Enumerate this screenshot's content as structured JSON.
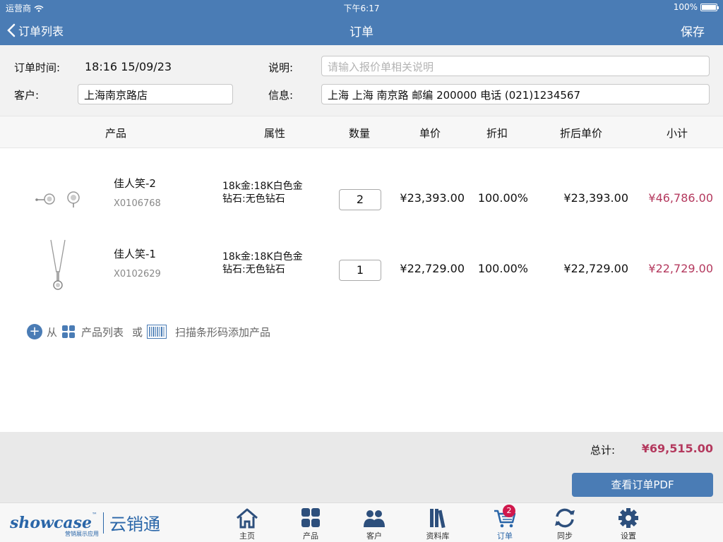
{
  "status": {
    "carrier": "运营商",
    "time": "下午6:17",
    "battery": "100%"
  },
  "nav": {
    "back_label": "订单列表",
    "title": "订单",
    "save_label": "保存"
  },
  "form": {
    "order_time_label": "订单时间:",
    "order_time_value": "18:16 15/09/23",
    "customer_label": "客户:",
    "customer_value": "上海南京路店",
    "note_label": "说明:",
    "note_placeholder": "请输入报价单相关说明",
    "info_label": "信息:",
    "info_value": "上海 上海 南京路 邮编 200000  电话 (021)1234567"
  },
  "table": {
    "headers": [
      "产品",
      "属性",
      "数量",
      "单价",
      "折扣",
      "折后单价",
      "小计"
    ],
    "rows": [
      {
        "name": "佳人笑-2",
        "sku": "X0106768",
        "attr1": "18k金:18K白色金",
        "attr2": "钻石:无色钻石",
        "qty": "2",
        "price": "¥23,393.00",
        "discount": "100.00%",
        "disc_price": "¥23,393.00",
        "subtotal": "¥46,786.00",
        "image": "earrings-icon"
      },
      {
        "name": "佳人笑-1",
        "sku": "X0102629",
        "attr1": "18k金:18K白色金",
        "attr2": "钻石:无色钻石",
        "qty": "1",
        "price": "¥22,729.00",
        "discount": "100.00%",
        "disc_price": "¥22,729.00",
        "subtotal": "¥22,729.00",
        "image": "necklace-icon"
      }
    ]
  },
  "add": {
    "from": "从",
    "product_list": "产品列表",
    "or": "或",
    "scan": "扫描条形码添加产品"
  },
  "footer": {
    "total_label": "总计:",
    "total_value": "¥69,515.00",
    "pdf_button": "查看订单PDF"
  },
  "brand": {
    "logo_text": "showcase",
    "tm": "™",
    "logo_sub": "营销展示应用",
    "cn": "云销通"
  },
  "tabs": [
    {
      "label": "主页",
      "icon": "home-icon"
    },
    {
      "label": "产品",
      "icon": "grid-icon"
    },
    {
      "label": "客户",
      "icon": "customers-icon"
    },
    {
      "label": "资料库",
      "icon": "library-icon"
    },
    {
      "label": "订单",
      "icon": "cart-icon",
      "badge": "2"
    },
    {
      "label": "同步",
      "icon": "sync-icon"
    },
    {
      "label": "设置",
      "icon": "gear-icon"
    }
  ],
  "colors": {
    "accent": "#4a7cb5",
    "price_red": "#b4395e",
    "badge": "#d0184c"
  }
}
